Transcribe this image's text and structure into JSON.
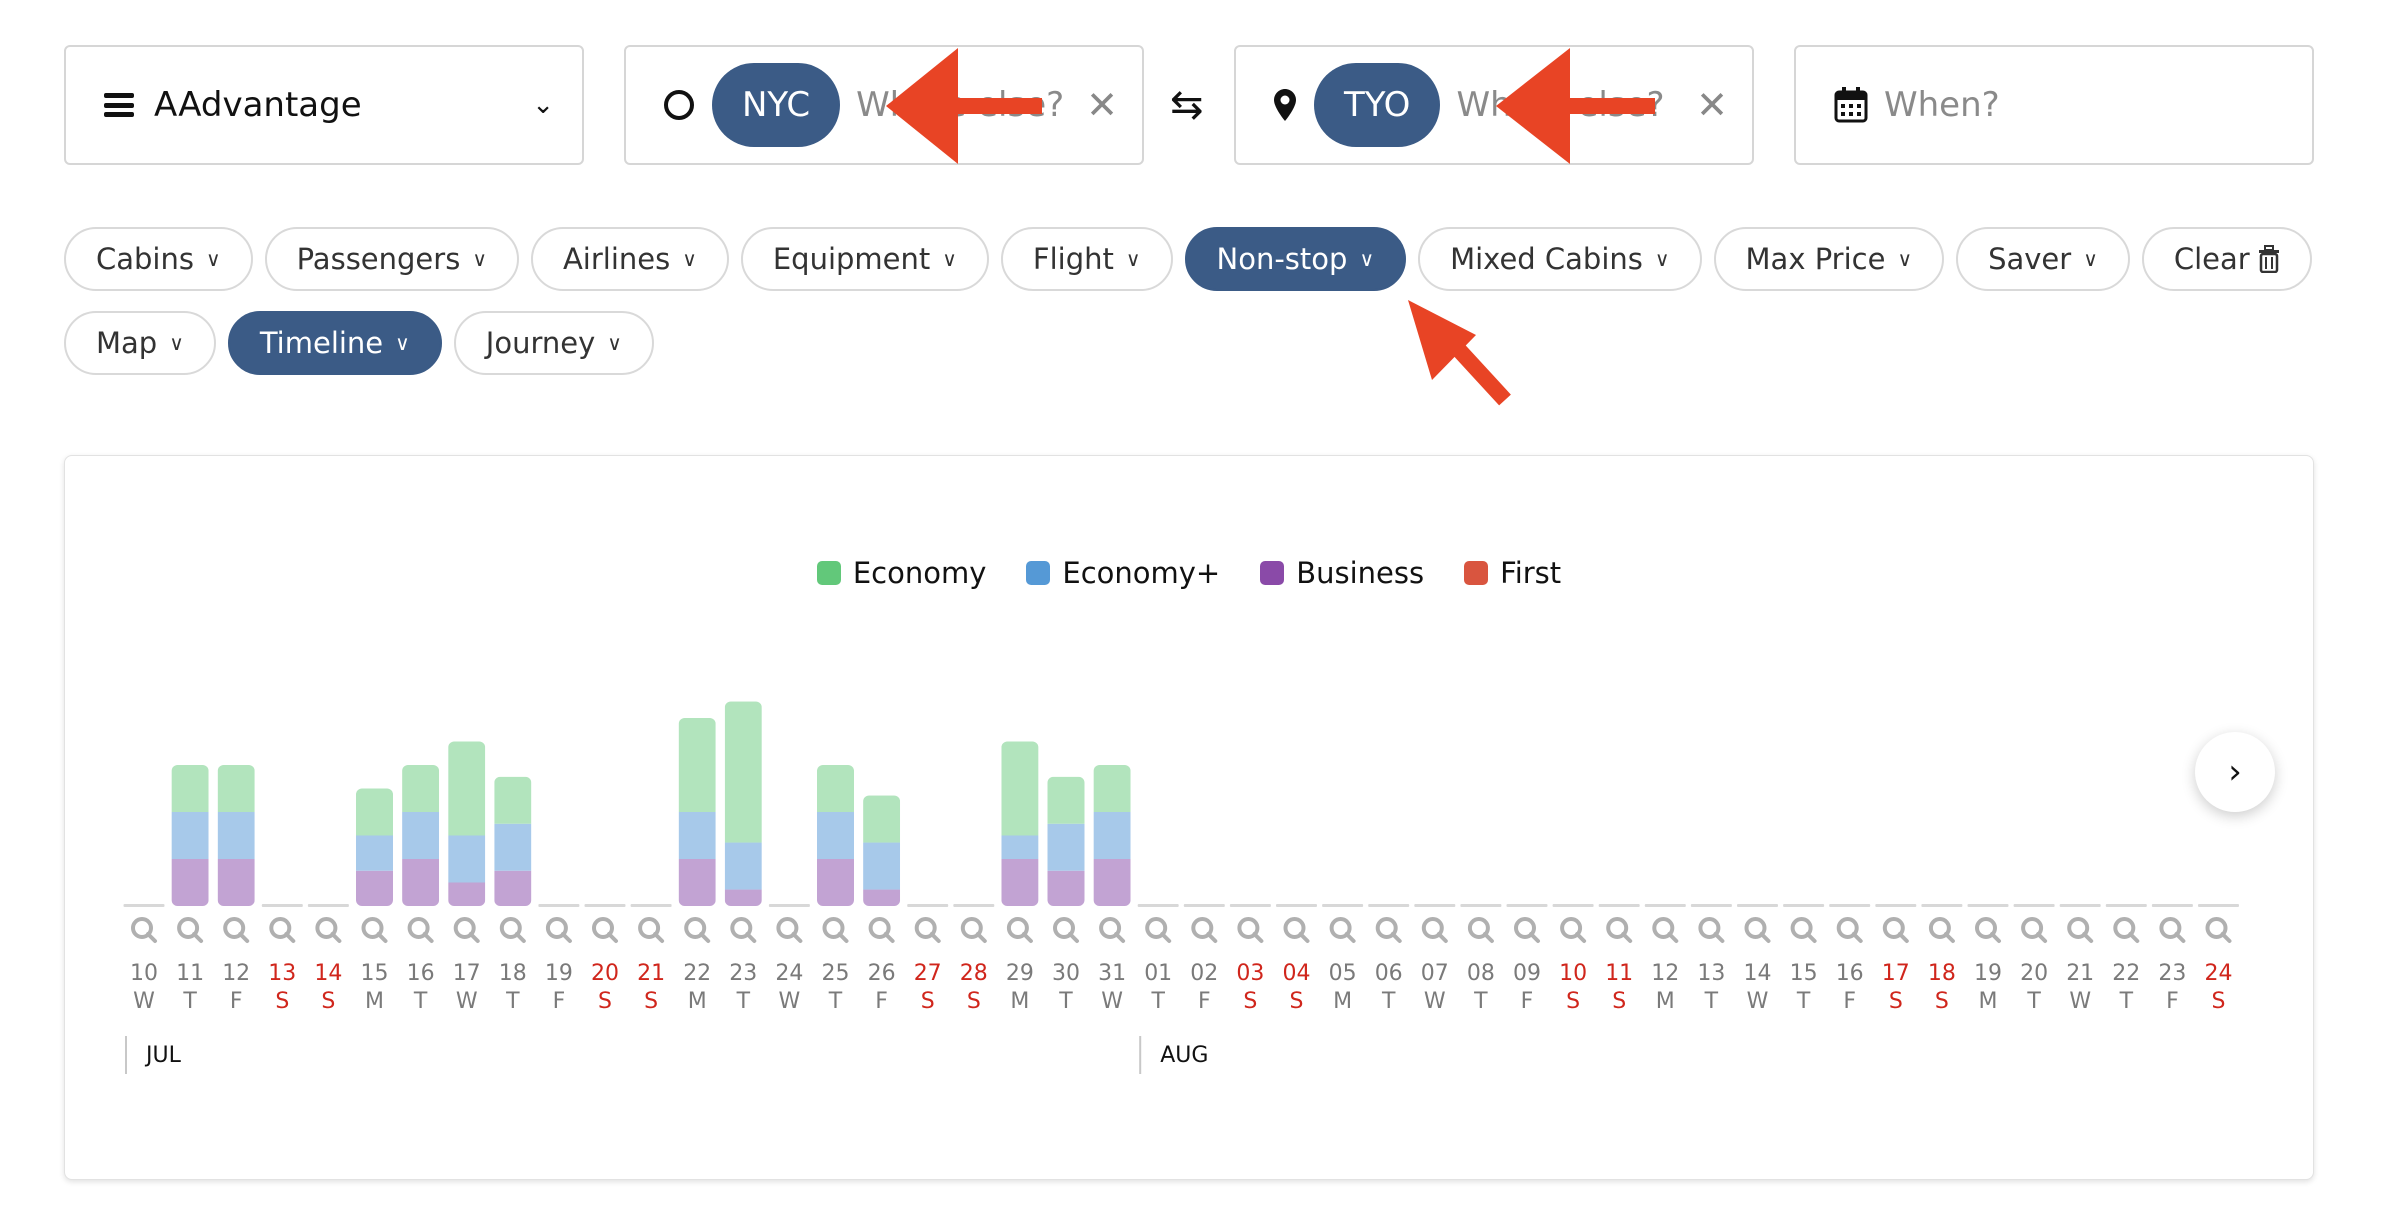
{
  "search": {
    "program": {
      "label": "AAdvantage",
      "icon": "menu-icon"
    },
    "origin": {
      "chip": "NYC",
      "placeholder": "Where else?",
      "icon": "origin-circle-icon"
    },
    "swap_icon": "swap-arrows-icon",
    "destination": {
      "chip": "TYO",
      "placeholder": "Where else?",
      "icon": "map-pin-icon"
    },
    "when": {
      "placeholder": "When?",
      "icon": "calendar-icon"
    }
  },
  "filters": {
    "row1": [
      {
        "label": "Cabins",
        "active": false
      },
      {
        "label": "Passengers",
        "active": false
      },
      {
        "label": "Airlines",
        "active": false
      },
      {
        "label": "Equipment",
        "active": false
      },
      {
        "label": "Flight",
        "active": false
      },
      {
        "label": "Non-stop",
        "active": true
      },
      {
        "label": "Mixed Cabins",
        "active": false
      },
      {
        "label": "Max Price",
        "active": false
      },
      {
        "label": "Saver",
        "active": false
      }
    ],
    "clear_label": "Clear",
    "row2": [
      {
        "label": "Map",
        "active": false
      },
      {
        "label": "Timeline",
        "active": true
      },
      {
        "label": "Journey",
        "active": false
      }
    ]
  },
  "colors": {
    "accent": "#3b5b86",
    "economy": "#62c87a",
    "economy_plus": "#5599d6",
    "business": "#8a4aa8",
    "first": "#d9553f",
    "weekend": "#d0261c",
    "weekday": "#7a7a7a",
    "annotation_arrow": "#e84425"
  },
  "chart_data": {
    "type": "bar",
    "stacked": true,
    "title": "",
    "xlabel": "",
    "ylabel": "",
    "legend": [
      "Economy",
      "Economy+",
      "Business",
      "First"
    ],
    "legend_position": "top-center",
    "grid": false,
    "months": [
      {
        "label": "JUL",
        "start_index": 0
      },
      {
        "label": "AUG",
        "start_index": 22
      }
    ],
    "categories": [
      "10",
      "11",
      "12",
      "13",
      "14",
      "15",
      "16",
      "17",
      "18",
      "19",
      "20",
      "21",
      "22",
      "23",
      "24",
      "25",
      "26",
      "27",
      "28",
      "29",
      "30",
      "31",
      "01",
      "02",
      "03",
      "04",
      "05",
      "06",
      "07",
      "08",
      "09",
      "10",
      "11",
      "12",
      "13",
      "14",
      "15",
      "16",
      "17",
      "18",
      "19",
      "20",
      "21",
      "22",
      "23",
      "24"
    ],
    "weekdays": [
      "W",
      "T",
      "F",
      "S",
      "S",
      "M",
      "T",
      "W",
      "T",
      "F",
      "S",
      "S",
      "M",
      "T",
      "W",
      "T",
      "F",
      "S",
      "S",
      "M",
      "T",
      "W",
      "T",
      "F",
      "S",
      "S",
      "M",
      "T",
      "W",
      "T",
      "F",
      "S",
      "S",
      "M",
      "T",
      "W",
      "T",
      "F",
      "S",
      "S",
      "M",
      "T",
      "W",
      "T",
      "F",
      "S"
    ],
    "series": [
      {
        "name": "Business",
        "values": [
          0,
          2,
          2,
          0,
          0,
          1.5,
          2,
          1,
          1.5,
          0,
          0,
          0,
          2,
          0.7,
          0,
          2,
          0.7,
          0,
          0,
          2,
          1.5,
          2,
          0,
          0,
          0,
          0,
          0,
          0,
          0,
          0,
          0,
          0,
          0,
          0,
          0,
          0,
          0,
          0,
          0,
          0,
          0,
          0,
          0,
          0,
          0,
          0
        ]
      },
      {
        "name": "Economy+",
        "values": [
          0,
          2,
          2,
          0,
          0,
          1.5,
          2,
          2,
          2,
          0,
          0,
          0,
          2,
          2,
          0,
          2,
          2,
          0,
          0,
          1,
          2,
          2,
          0,
          0,
          0,
          0,
          0,
          0,
          0,
          0,
          0,
          0,
          0,
          0,
          0,
          0,
          0,
          0,
          0,
          0,
          0,
          0,
          0,
          0,
          0,
          0
        ]
      },
      {
        "name": "Economy",
        "values": [
          0,
          2,
          2,
          0,
          0,
          2,
          2,
          4,
          2,
          0,
          0,
          0,
          4,
          6,
          0,
          2,
          2,
          0,
          0,
          4,
          2,
          2,
          0,
          0,
          0,
          0,
          0,
          0,
          0,
          0,
          0,
          0,
          0,
          0,
          0,
          0,
          0,
          0,
          0,
          0,
          0,
          0,
          0,
          0,
          0,
          0
        ]
      },
      {
        "name": "First",
        "values": [
          0,
          0,
          0,
          0,
          0,
          0,
          0,
          0,
          0,
          0,
          0,
          0,
          0,
          0,
          0,
          0,
          0,
          0,
          0,
          0,
          0,
          0,
          0,
          0,
          0,
          0,
          0,
          0,
          0,
          0,
          0,
          0,
          0,
          0,
          0,
          0,
          0,
          0,
          0,
          0,
          0,
          0,
          0,
          0,
          0,
          0
        ]
      }
    ],
    "ylim": [
      0,
      8
    ]
  },
  "chart_controls": {
    "next_icon": "chevron-right-icon",
    "search_icon": "magnifier-icon"
  }
}
